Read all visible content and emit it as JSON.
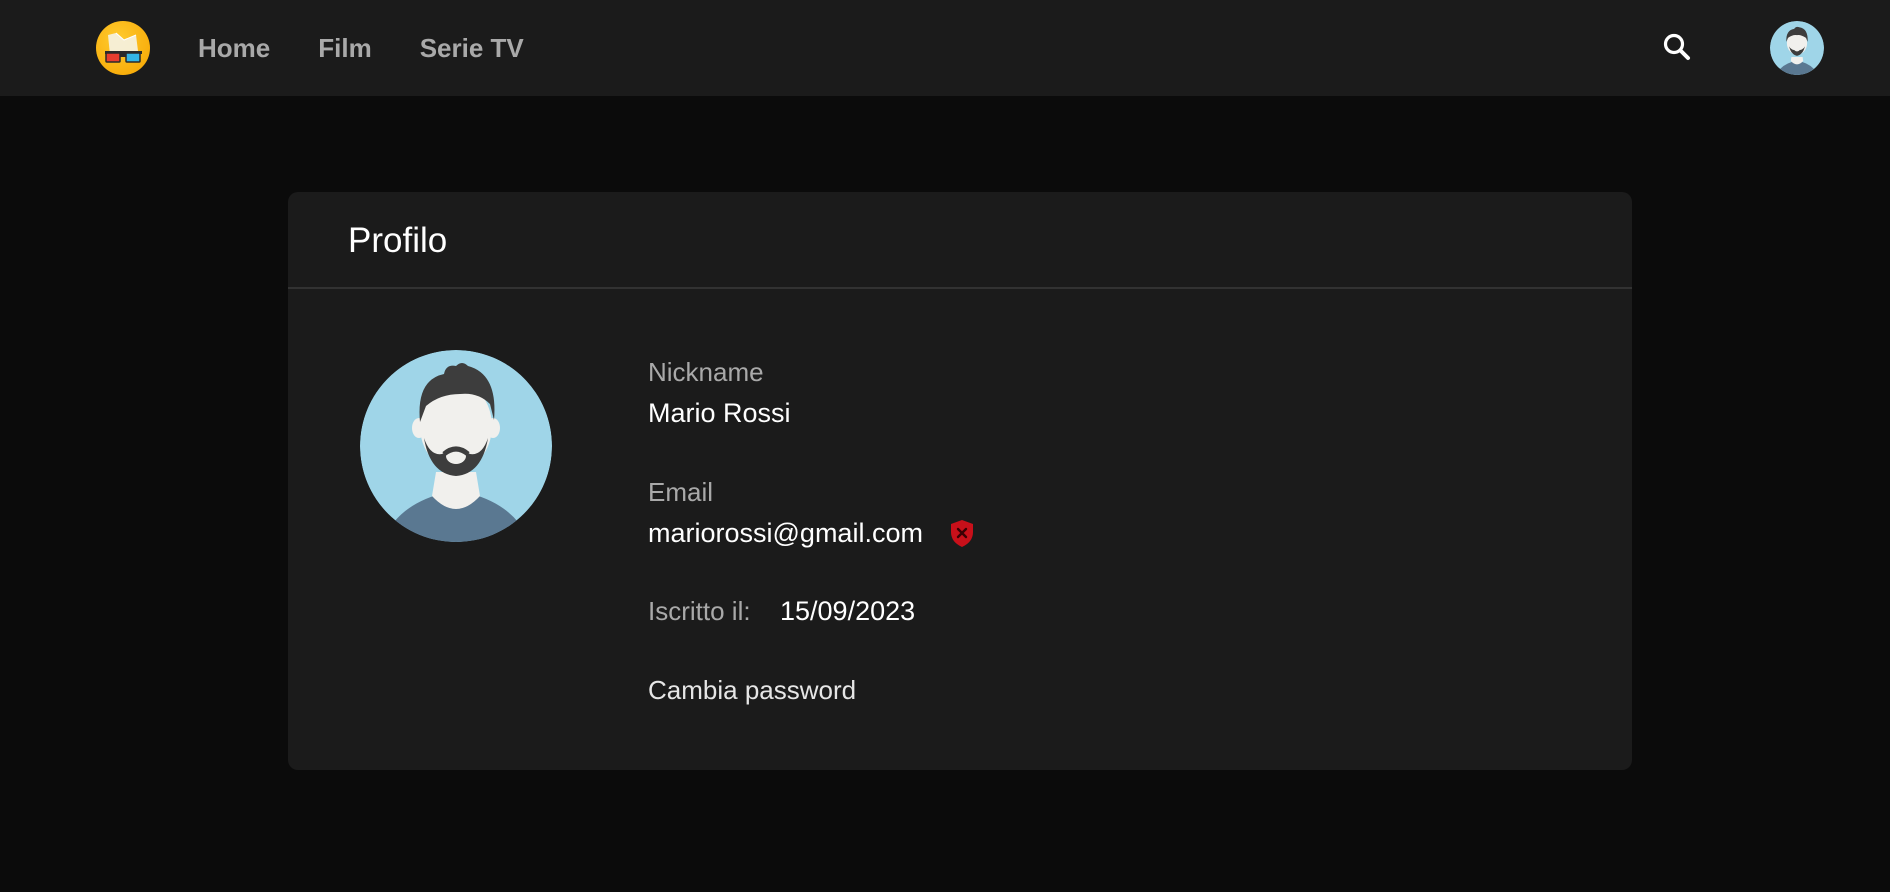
{
  "nav": {
    "logo_icon": "3d-glasses-logo-icon",
    "links": [
      "Home",
      "Film",
      "Serie TV"
    ],
    "search_icon": "search-icon",
    "avatar_icon": "user-avatar-icon"
  },
  "profile": {
    "title": "Profilo",
    "avatar_icon": "bearded-man-avatar-icon",
    "nickname_label": "Nickname",
    "nickname": "Mario Rossi",
    "email_label": "Email",
    "email": "mariorossi@gmail.com",
    "email_status_icon": "shield-x-icon",
    "joined_label": "Iscritto il:",
    "joined_date": "15/09/2023",
    "change_password": "Cambia password"
  },
  "colors": {
    "page_background": "#0b0b0b",
    "surface": "#1b1b1b",
    "logo_accent": "#f8ad0b",
    "unverified_badge": "#c8101a",
    "avatar_background": "#9fd5e8"
  }
}
